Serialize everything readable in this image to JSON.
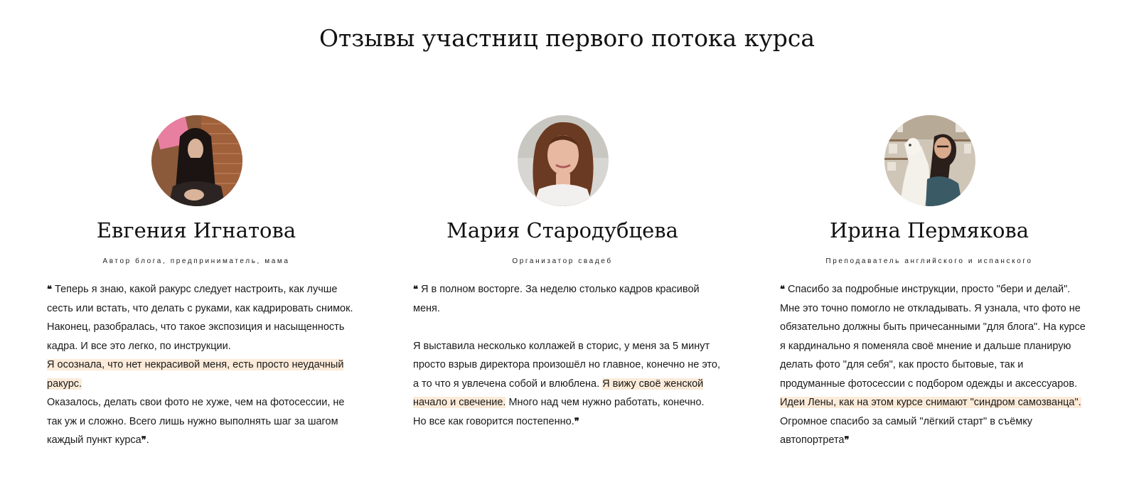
{
  "section": {
    "title": "Отзывы участниц первого потока курса"
  },
  "colors": {
    "highlight": "#fcebd9",
    "text": "#111111"
  },
  "reviews": [
    {
      "name": "Евгения Игнатова",
      "role": "Автор блога, предприниматель, мама",
      "avatar_icon": "avatar-photo",
      "open_quote": "❝",
      "p1": " Теперь я знаю, какой ракурс следует настроить, как лучше сесть или встать, что делать с руками, как кадрировать снимок. Наконец, разобралась, что такое экспозиция и насыщенность кадра. И все это легко, по инструкции.",
      "p2_highlight": "Я осознала, что нет некрасивой меня, есть просто неудачный ракурс.",
      "p3": "Оказалось, делать свои фото не хуже, чем на фотосессии, не так уж и сложно. Всего лишь нужно выполнять шаг за шагом каждый пункт курса",
      "close_quote": "❞",
      "p3_end": "."
    },
    {
      "name": "Мария Стародубцева",
      "role": "Организатор свадеб",
      "avatar_icon": "avatar-photo",
      "open_quote": "❝",
      "p1": " Я в полном восторге. За неделю столько кадров красивой меня.",
      "p2_before": "Я выставила несколько коллажей в сторис, у меня за 5 минут просто взрыв директора произошёл но главное, конечно не это, а то что я увлечена собой и влюблена. ",
      "p2_highlight": "Я вижу своё женской начало и свечение.",
      "p2_after": " Много над чем нужно работать, конечно. Но все как говорится постепенно.",
      "close_quote": "❞"
    },
    {
      "name": "Ирина Пермякова",
      "role": "Преподаватель английского и испанского",
      "avatar_icon": "avatar-photo",
      "open_quote": "❝",
      "p1_before": " Спасибо за подробные инструкции, просто \"бери и делай\". Мне это точно помогло не откладывать. Я узнала, что фото не обязательно должны быть причесанными \"для блога\". На курсе я кардинально я поменяла своё мнение и дальше планирую делать фото \"для себя\", как просто бытовые, так и продуманные фотосессии с подбором одежды и аксессуаров. ",
      "p1_highlight": "Идеи Лены, как на этом курсе снимают \"синдром самозванца\".",
      "p1_after": " Огромное спасибо за самый \"лёгкий старт\" в съёмку автопортрета",
      "close_quote": "❞"
    }
  ]
}
